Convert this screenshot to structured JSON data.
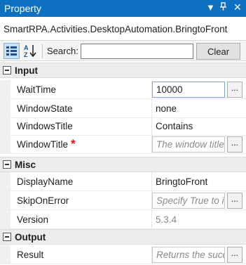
{
  "window": {
    "title": "Property",
    "controls": [
      "dropdown-icon",
      "pin-icon",
      "close-icon"
    ]
  },
  "activity_name": "SmartRPA.Activities.DesktopAutomation.BringtoFront",
  "toolbar": {
    "categorized_icon": "categorized-icon",
    "alphabetical_icon": "sort-az-icon",
    "search_label": "Search:",
    "search_value": "",
    "clear_label": "Clear"
  },
  "sections": {
    "input": {
      "label": "Input",
      "wait_time": {
        "name": "WaitTime",
        "value": "10000",
        "button": "..."
      },
      "window_state": {
        "name": "WindowState",
        "value": "none"
      },
      "windows_title": {
        "name": "WindowsTitle",
        "value": "Contains"
      },
      "window_title": {
        "name": "WindowTitle",
        "required_mark": "*",
        "placeholder": "The window title",
        "button": "..."
      }
    },
    "misc": {
      "label": "Misc",
      "display_name": {
        "name": "DisplayName",
        "value": "BringtoFront"
      },
      "skip_on_error": {
        "name": "SkipOnError",
        "placeholder": "Specify True to ignore errors",
        "button": "..."
      },
      "version": {
        "name": "Version",
        "value": "5.3.4"
      }
    },
    "output": {
      "label": "Output",
      "result": {
        "name": "Result",
        "placeholder": "Returns the success flag",
        "button": "..."
      }
    }
  },
  "colors": {
    "titlebar": "#0e70c0",
    "required": "#e01010",
    "category_bg": "#ececec"
  }
}
